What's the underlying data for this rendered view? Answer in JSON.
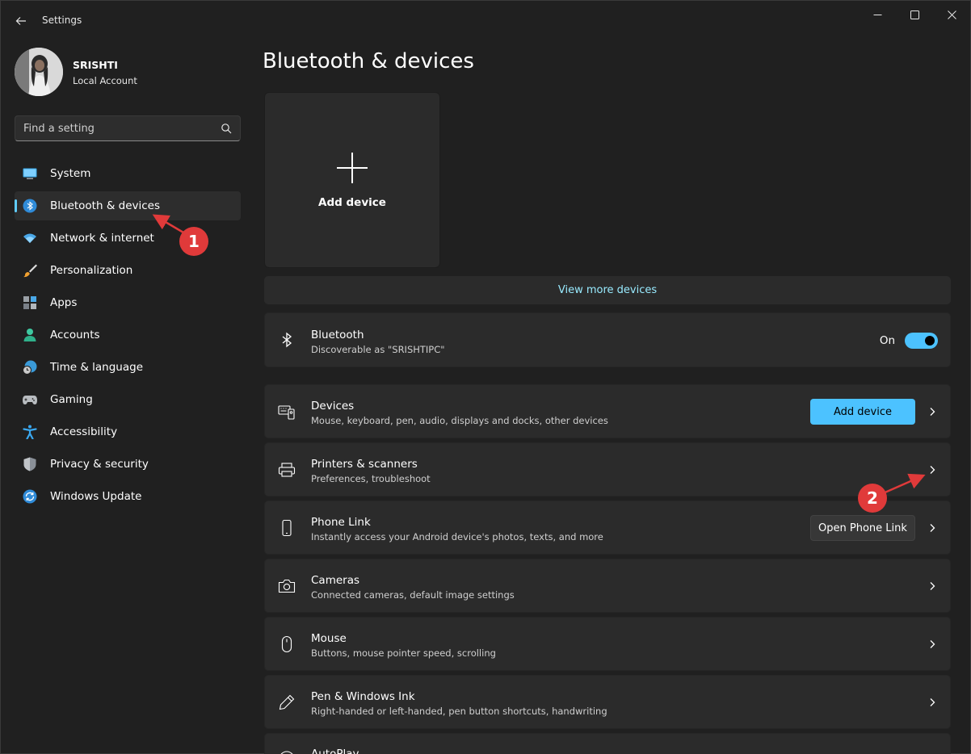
{
  "window": {
    "title": "Settings"
  },
  "profile": {
    "name": "SRISHTI",
    "account_type": "Local Account"
  },
  "search": {
    "placeholder": "Find a setting"
  },
  "nav": {
    "items": [
      {
        "label": "System",
        "icon": "monitor-icon",
        "active": false
      },
      {
        "label": "Bluetooth & devices",
        "icon": "bluetooth-icon",
        "active": true
      },
      {
        "label": "Network & internet",
        "icon": "wifi-icon",
        "active": false
      },
      {
        "label": "Personalization",
        "icon": "brush-icon",
        "active": false
      },
      {
        "label": "Apps",
        "icon": "apps-icon",
        "active": false
      },
      {
        "label": "Accounts",
        "icon": "person-icon",
        "active": false
      },
      {
        "label": "Time & language",
        "icon": "globe-clock-icon",
        "active": false
      },
      {
        "label": "Gaming",
        "icon": "gamepad-icon",
        "active": false
      },
      {
        "label": "Accessibility",
        "icon": "accessibility-icon",
        "active": false
      },
      {
        "label": "Privacy & security",
        "icon": "shield-icon",
        "active": false
      },
      {
        "label": "Windows Update",
        "icon": "update-icon",
        "active": false
      }
    ]
  },
  "main": {
    "title": "Bluetooth & devices",
    "add_tile_label": "Add device",
    "view_more": "View more devices",
    "bluetooth": {
      "title": "Bluetooth",
      "subtitle": "Discoverable as \"SRISHTIPC\"",
      "state_label": "On",
      "enabled": true
    },
    "rows": [
      {
        "title": "Devices",
        "subtitle": "Mouse, keyboard, pen, audio, displays and docks, other devices",
        "icon": "keyboard-device-icon",
        "button": "Add device"
      },
      {
        "title": "Printers & scanners",
        "subtitle": "Preferences, troubleshoot",
        "icon": "printer-icon"
      },
      {
        "title": "Phone Link",
        "subtitle": "Instantly access your Android device's photos, texts, and more",
        "icon": "phone-icon",
        "button": "Open Phone Link"
      },
      {
        "title": "Cameras",
        "subtitle": "Connected cameras, default image settings",
        "icon": "camera-icon"
      },
      {
        "title": "Mouse",
        "subtitle": "Buttons, mouse pointer speed, scrolling",
        "icon": "mouse-icon"
      },
      {
        "title": "Pen & Windows Ink",
        "subtitle": "Right-handed or left-handed, pen button shortcuts, handwriting",
        "icon": "pen-icon"
      },
      {
        "title": "AutoPlay",
        "icon": "autoplay-icon"
      }
    ]
  },
  "annotations": {
    "step1": "1",
    "step2": "2"
  },
  "colors": {
    "accent": "#4cc2ff",
    "annotation": "#e03a3a",
    "background": "#202020",
    "card": "#2b2b2b"
  }
}
